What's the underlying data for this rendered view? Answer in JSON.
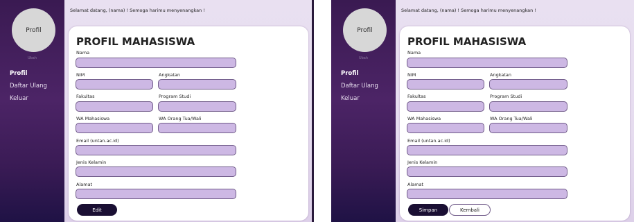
{
  "common": {
    "avatar_text": "Profil",
    "avatar_caption": "Ubah",
    "menu": [
      "Profil",
      "Daftar Ulang",
      "Keluar"
    ],
    "welcome": "Selamat datang, (nama) ! Semoga harimu menyenangkan !",
    "title": "PROFIL MAHASISWA",
    "labels": {
      "nama": "Nama",
      "nim": "NIM",
      "angkatan": "Angkatan",
      "fakultas": "Fakultas",
      "prodi": "Program Studi",
      "wa_mhs": "WA Mahasiswa",
      "wa_ortu": "WA Orang Tua/Wali",
      "email": "Email (untan.ac.id)",
      "gender": "Jenis Kelamin",
      "alamat": "Alamat"
    }
  },
  "left": {
    "edit_label": "Edit"
  },
  "right": {
    "save_label": "Simpan",
    "back_label": "Kembali"
  },
  "colors": {
    "sidebar": "#3a1a52",
    "field_fill": "#cdb8e4",
    "field_border": "#6f5a88",
    "button_dark": "#1a0f33"
  }
}
